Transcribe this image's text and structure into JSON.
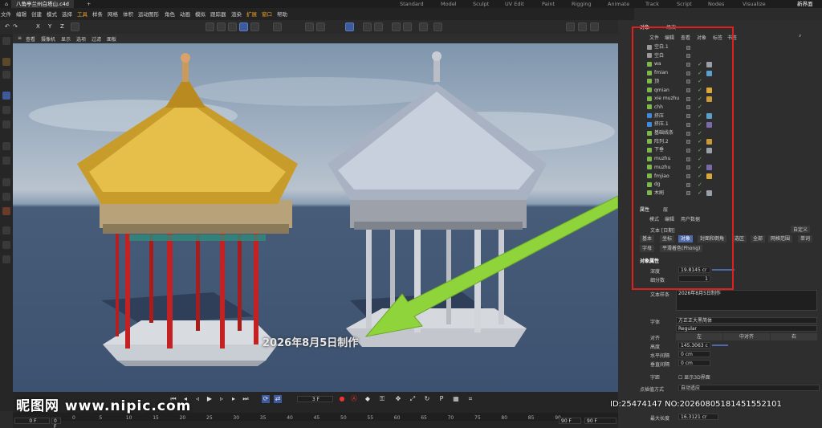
{
  "window": {
    "file_tab": "八角亭兰州白塔山.c4d",
    "layout_name": "新界面"
  },
  "workspaces": [
    "Standard",
    "Model",
    "Sculpt",
    "UV Edit",
    "Paint",
    "Rigging",
    "Animate",
    "Track",
    "Script",
    "Nodes",
    "Visualize"
  ],
  "menu": [
    "文件",
    "编辑",
    "创建",
    "模式",
    "选择",
    "工具",
    "样条",
    "网格",
    "体积",
    "运动图形",
    "角色",
    "动画",
    "模拟",
    "跟踪器",
    "渲染",
    "扩展",
    "窗口",
    "帮助"
  ],
  "toolbar": {
    "axes": [
      "X",
      "Y",
      "Z"
    ]
  },
  "viewport_menu": [
    "查看",
    "摄像机",
    "显示",
    "选项",
    "过滤",
    "面板"
  ],
  "viewport_overlay_text": "2026年8月5日制作",
  "object_manager": {
    "tabs": [
      "对象",
      "场次"
    ],
    "menu": [
      "文件",
      "编辑",
      "查看",
      "对象",
      "标签",
      "书签"
    ],
    "objects": [
      "空白.1",
      "空白",
      "wa",
      "fmian",
      "顶",
      "qmian",
      "xie muzhu",
      "chh",
      "挤压",
      "挤压.1",
      "基础线条",
      "阵列.2",
      "下垂",
      "muzhu",
      "muzhu",
      "fmjiao",
      "dg",
      "木刷"
    ]
  },
  "attributes": {
    "tabs": [
      "属性",
      "层"
    ],
    "menu": [
      "模式",
      "编辑",
      "用户数据"
    ],
    "object_name": "文本 [日期]",
    "preset": "自定义",
    "tab_row1": [
      "基本",
      "坐标",
      "对象",
      "封面和倒角",
      "选区",
      "全部",
      "网格范围",
      "单词"
    ],
    "tab_row2": [
      "字母",
      "平滑着色(Phong)"
    ],
    "section": "对象属性",
    "depth_label": "深度",
    "depth_value": "19.8145 cr",
    "subdiv_label": "细分数",
    "subdiv_value": "1",
    "text_label": "文本样条",
    "text_value": "2026年8月5日制作",
    "font_label": "字体",
    "font_value": "方正正大黑简体",
    "font_style": "Regular",
    "align_label": "对齐",
    "align_options": [
      "左",
      "中对齐",
      "右"
    ],
    "height_label": "高度",
    "height_value": "145.3063 c",
    "hspace_label": "水平间隔",
    "hspace_value": "0 cm",
    "vspace_label": "垂直间隔",
    "vspace_value": "0 cm",
    "kerning_label": "字距",
    "show3d_label": "显示3D界面",
    "interp_label": "点插值方式",
    "interp_value": "自动适应",
    "maxlen_label": "最大长度",
    "maxlen_value": "16.3121 cr"
  },
  "timeline": {
    "current_frame": "3 F",
    "start": "0 F",
    "start2": "0 F",
    "end": "90 F",
    "end2": "90 F",
    "ticks": [
      "0",
      "5",
      "10",
      "15",
      "20",
      "25",
      "30",
      "35",
      "40",
      "45",
      "50",
      "55",
      "60",
      "65",
      "70",
      "75",
      "80",
      "85",
      "90"
    ]
  },
  "watermark": {
    "brand": "昵图网 www.nipic.com",
    "id_text": "ID:25474147 NO:20260805181451552101"
  },
  "colors": {
    "accent": "#4e6aa8",
    "highlight_box": "#e0201e",
    "arrow": "#8fd43a"
  }
}
